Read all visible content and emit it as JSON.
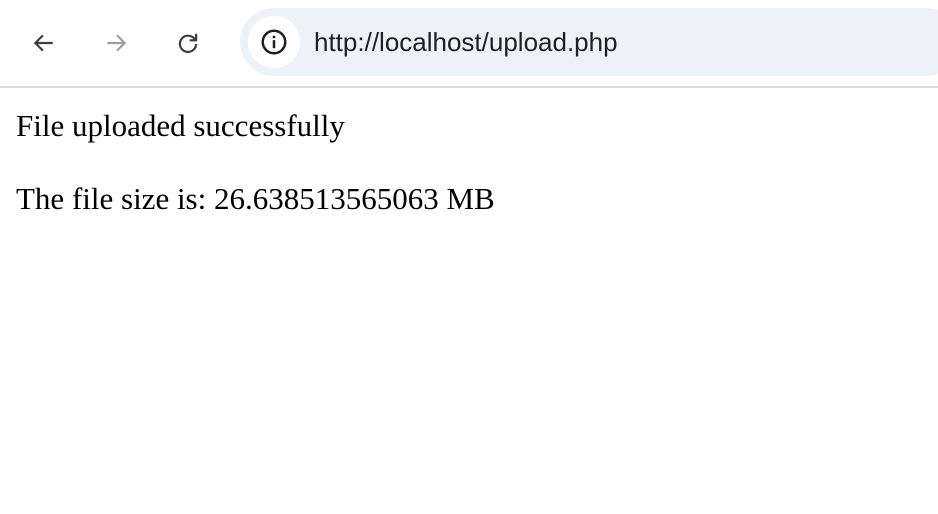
{
  "browser": {
    "url": "http://localhost/upload.php",
    "buttons": {
      "back": "back-arrow-icon",
      "forward": "forward-arrow-icon",
      "reload": "reload-icon",
      "site_info": "info-icon"
    },
    "colors": {
      "omnibox_background": "#edf2fa",
      "icon_active": "#3c3c3c",
      "icon_disabled": "#9e9e9e"
    }
  },
  "page": {
    "message": "File uploaded successfully",
    "file_size_text": "The file size is: 26.638513565063 MB"
  }
}
